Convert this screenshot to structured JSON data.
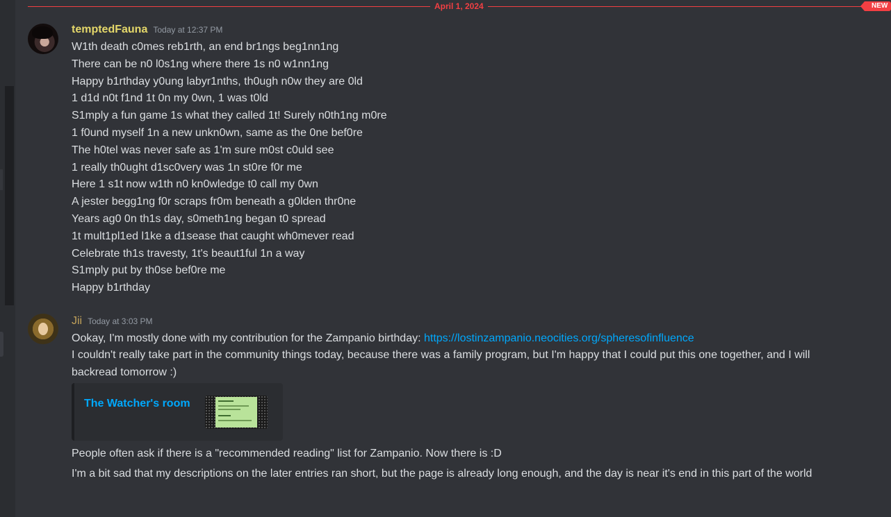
{
  "divider": {
    "date": "April 1, 2024",
    "badge": "NEW"
  },
  "messages": [
    {
      "username": "temptedFauna",
      "timestamp": "Today at 12:37 PM",
      "lines": [
        "W1th death c0mes reb1rth, an end br1ngs beg1nn1ng",
        "There can be n0 l0s1ng where there 1s n0 w1nn1ng",
        "Happy b1rthday y0ung labyr1nths, th0ugh n0w they are 0ld",
        "1 d1d n0t f1nd 1t 0n my 0wn, 1 was t0ld",
        "S1mply a fun game 1s what they called 1t! Surely n0th1ng m0re",
        "1 f0und myself 1n a new unkn0wn, same as the 0ne bef0re",
        "The h0tel was never safe as 1'm sure m0st c0uld see",
        "1 really th0ught d1sc0very was 1n st0re f0r me",
        "Here 1 s1t now w1th n0 kn0wledge t0 call my 0wn",
        "A jester begg1ng f0r scraps fr0m beneath a g0lden thr0ne",
        "Years ag0 0n th1s day, s0meth1ng began t0 spread",
        "1t mult1pl1ed l1ke a d1sease that caught wh0mever read",
        "Celebrate th1s travesty, 1t's beaut1ful 1n a way",
        "S1mply put by th0se bef0re me",
        "Happy b1rthday"
      ]
    },
    {
      "username": "Jii",
      "timestamp": "Today at 3:03 PM",
      "line1_text": "Ookay, I'm mostly done with my contribution for the Zampanio birthday: ",
      "line1_link": "https://lostinzampanio.neocities.org/spheresofinfluence",
      "line2": "I couldn't really take part in the community things today, because there was a family program, but I'm happy that I could put this one together, and I will backread tomorrow :)",
      "embed_title": "The Watcher's room",
      "line3": "People often ask if there is a \"recommended reading\" list for Zampanio. Now there is :D",
      "line4": "I'm a bit sad that my descriptions on the later entries ran short, but the page is already long enough, and the day is near it's end in this part of the world"
    }
  ],
  "colors": {
    "background": "#313338",
    "divider": "#f23f43",
    "username1": "#e5d86a",
    "username2": "#c2a25a",
    "link": "#00a8fc",
    "text": "#dbdee1",
    "timestamp": "#949ba4"
  }
}
